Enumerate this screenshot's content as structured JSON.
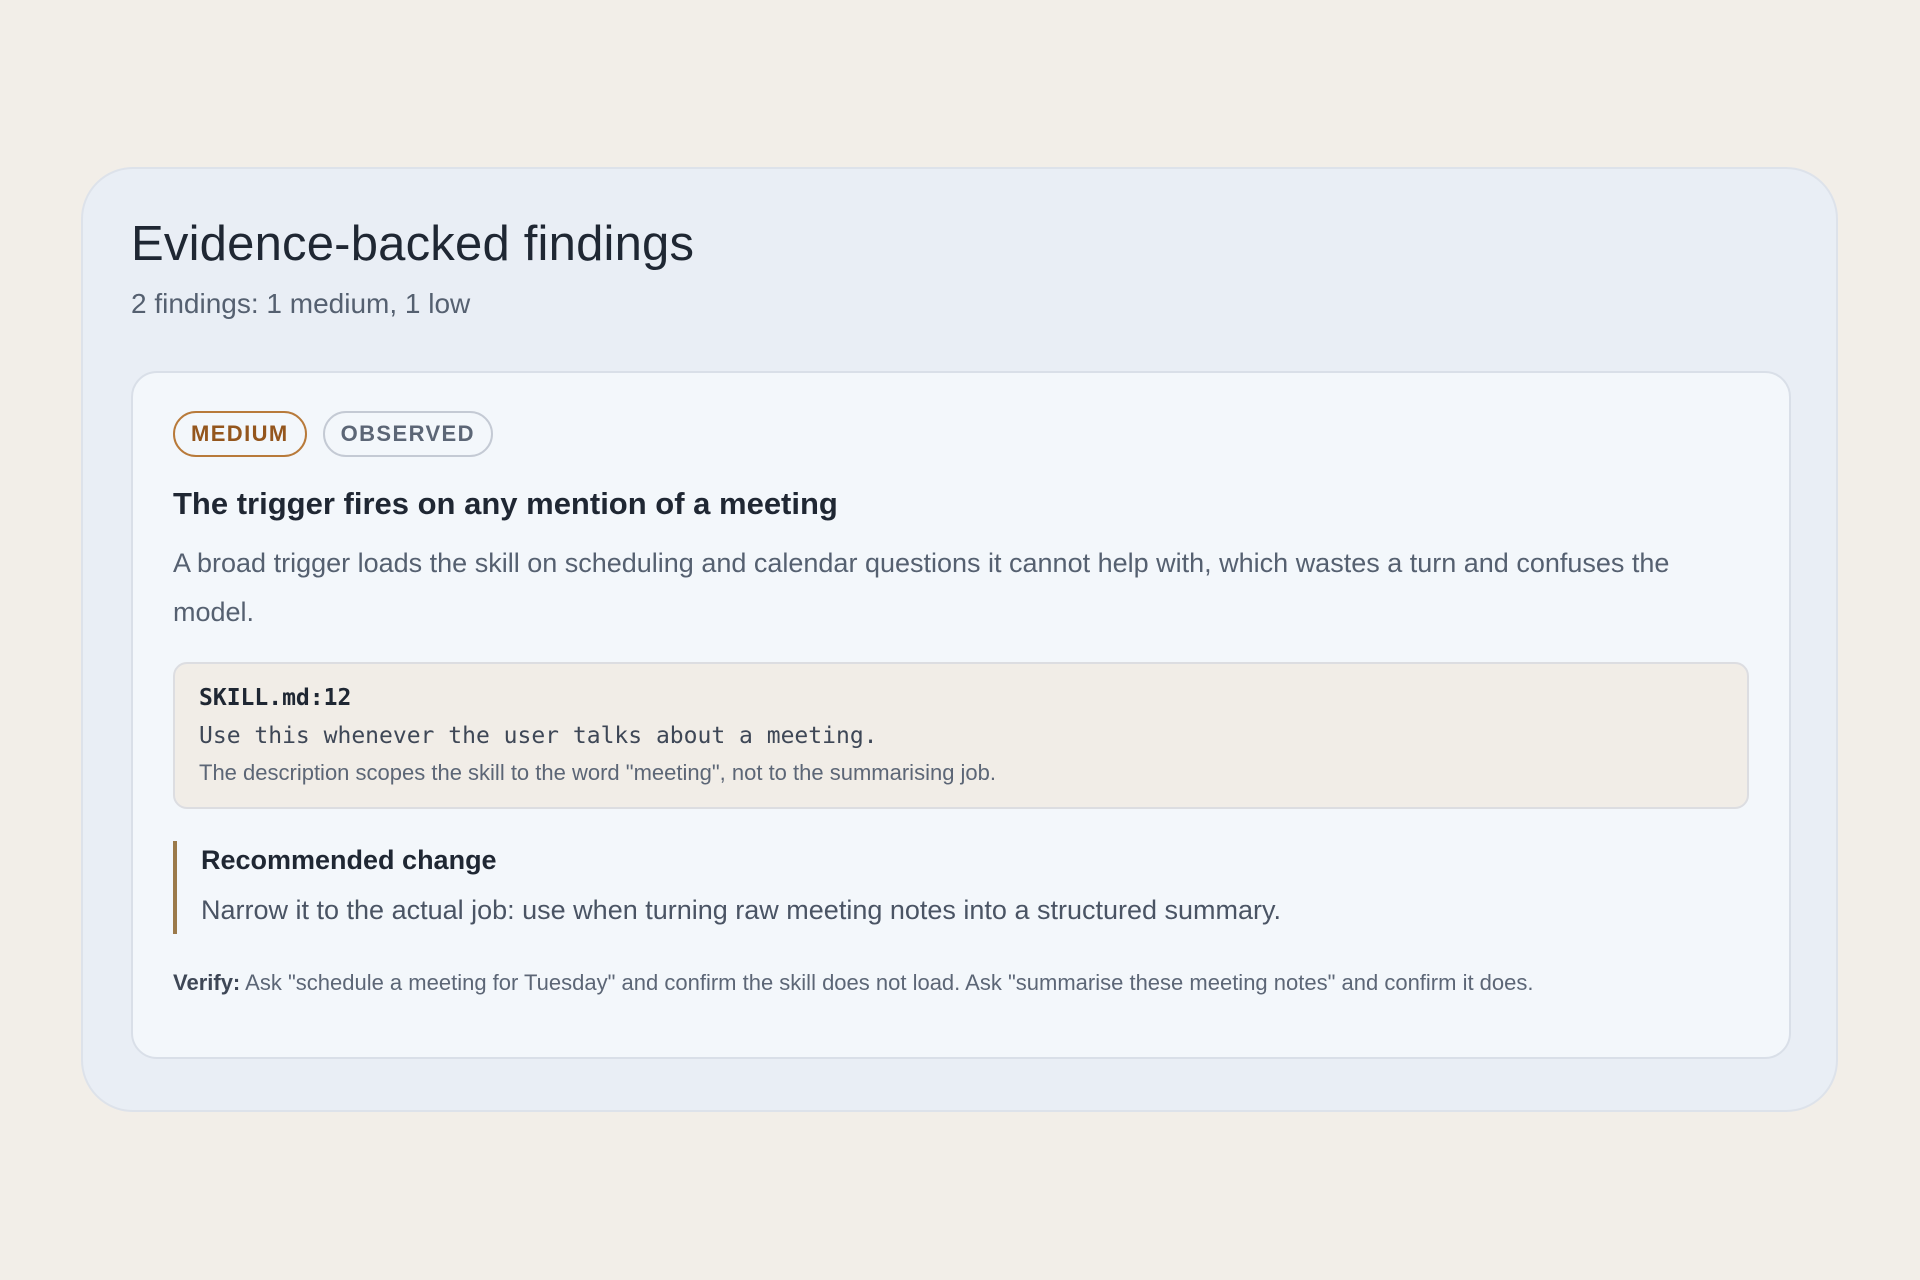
{
  "section": {
    "title": "Evidence-backed findings",
    "subtitle": "2 findings: 1 medium, 1 low"
  },
  "finding": {
    "badges": {
      "severity": "MEDIUM",
      "status": "OBSERVED"
    },
    "title": "The trigger fires on any mention of a meeting",
    "description": "A broad trigger loads the skill on scheduling and calendar questions it cannot help with, which wastes a turn and confuses the model.",
    "evidence": {
      "ref": "SKILL.md:12",
      "quote": "Use this whenever the user talks about a meeting.",
      "note": "The description scopes the skill to the word \"meeting\", not to the summarising job."
    },
    "recommendation": {
      "title": "Recommended change",
      "text": "Narrow it to the actual job: use when turning raw meeting notes into a structured summary."
    },
    "verify": {
      "label": "Verify:",
      "text": " Ask \"schedule a meeting for Tuesday\" and confirm the skill does not load. Ask \"summarise these meeting notes\" and confirm it does."
    }
  },
  "colors": {
    "page_background": "#f2eee8",
    "outer_card": "#e9eef5",
    "finding_card": "#f3f7fb",
    "evidence_box": "#f1ede7",
    "medium_accent": "#94561d",
    "recommend_bar": "#9b7a4a",
    "text_primary": "#1f2733",
    "text_secondary": "#556070"
  }
}
